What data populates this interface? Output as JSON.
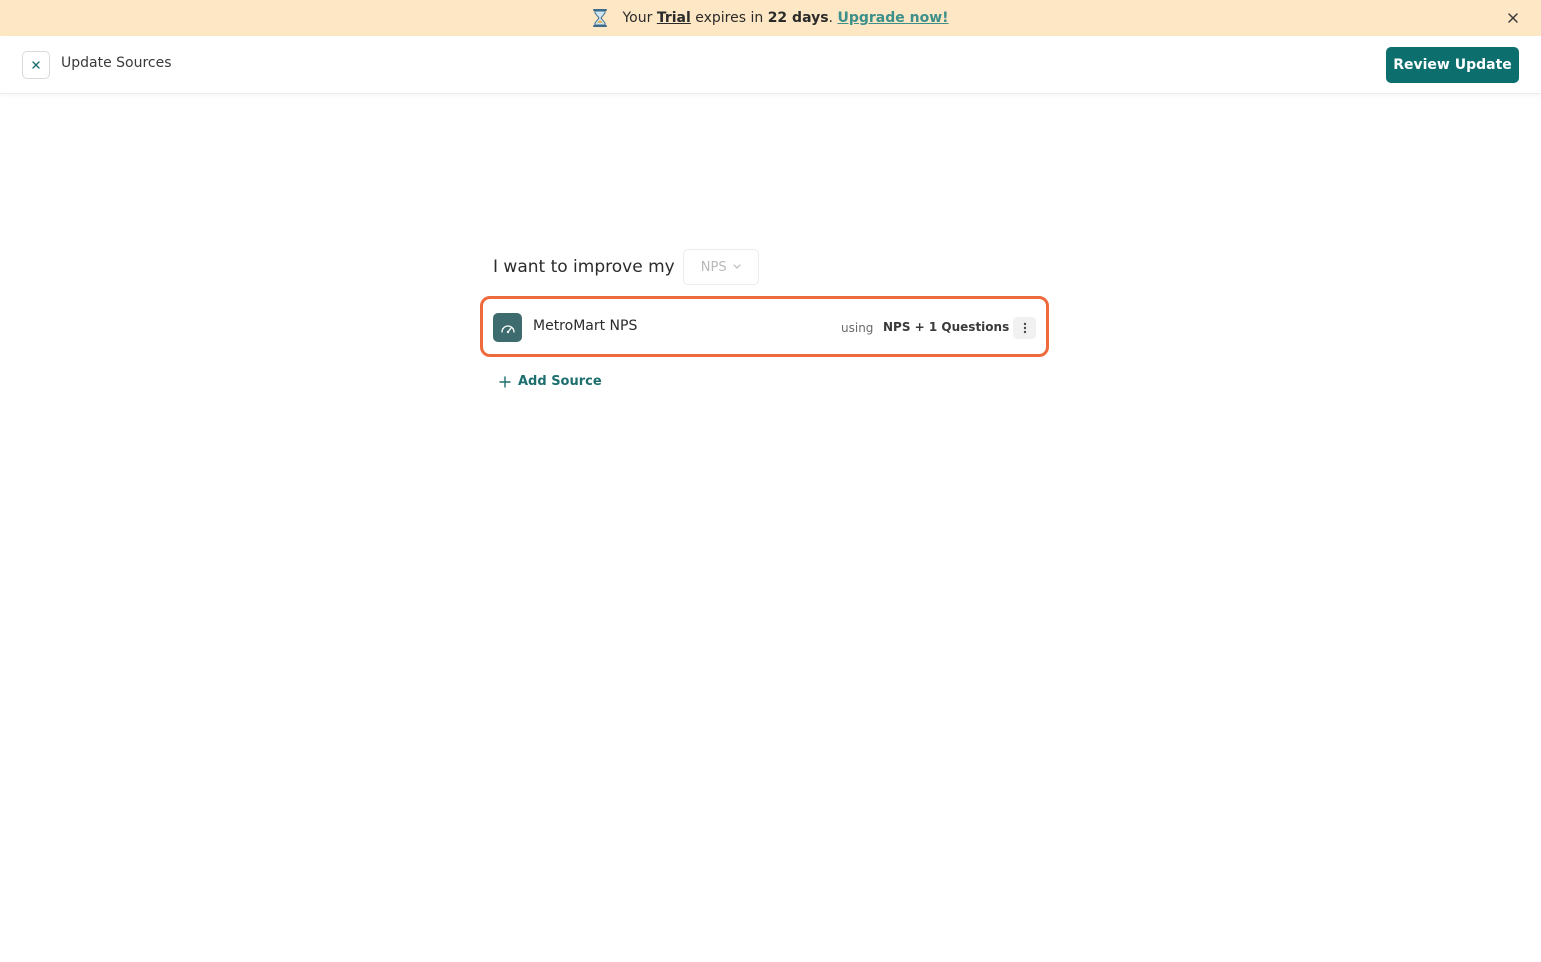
{
  "banner": {
    "prefix": "Your",
    "trial": "Trial",
    "middle": "expires in",
    "days": "22 days",
    "period": ".",
    "upgrade": "Upgrade now!"
  },
  "header": {
    "title": "Update Sources",
    "review_label": "Review Update"
  },
  "goal": {
    "label": "I want to improve my",
    "metric": "NPS"
  },
  "sources": [
    {
      "name": "MetroMart NPS",
      "using_label": "using",
      "questions": "NPS + 1 Questions"
    }
  ],
  "add_source_label": "Add Source",
  "colors": {
    "brand": "#0d6e6e",
    "banner_bg": "#fde7c4",
    "highlight": "#ee6a3d",
    "link": "#3d8f8a"
  }
}
